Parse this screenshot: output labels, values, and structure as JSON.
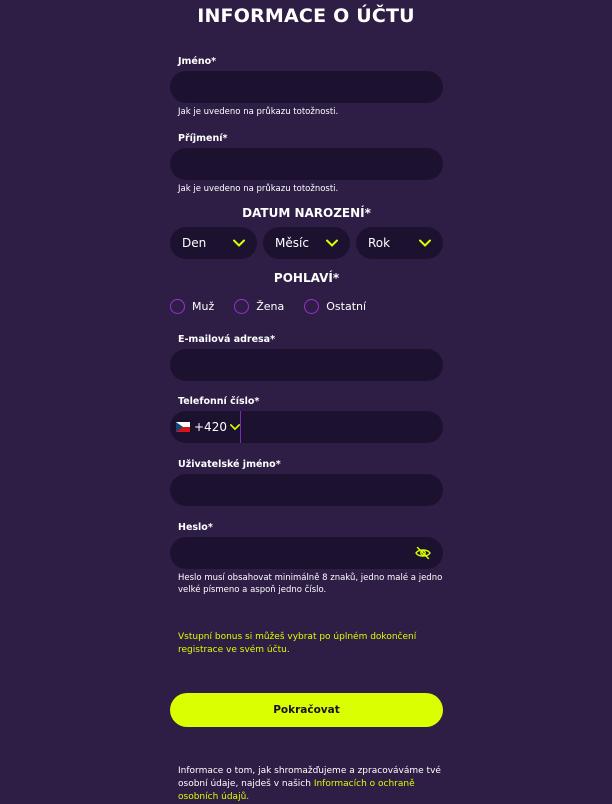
{
  "page_title": "INFORMACE O ÚČTU",
  "first_name": {
    "label": "Jméno*",
    "hint": "Jak je uvedeno na průkazu totožnosti.",
    "value": ""
  },
  "last_name": {
    "label": "Příjmení*",
    "hint": "Jak je uvedeno na průkazu totožnosti.",
    "value": ""
  },
  "birth_date": {
    "heading": "DATUM NAROZENÍ*",
    "day": "Den",
    "month": "Měsíc",
    "year": "Rok"
  },
  "gender": {
    "heading": "POHLAVÍ*",
    "options": [
      "Muž",
      "Žena",
      "Ostatní"
    ]
  },
  "email": {
    "label": "E-mailová adresa*",
    "value": ""
  },
  "phone": {
    "label": "Telefonní číslo*",
    "country_code": "+420",
    "flag": "czech-flag-icon",
    "value": ""
  },
  "username": {
    "label": "Uživatelské jméno*",
    "value": ""
  },
  "password": {
    "label": "Heslo*",
    "hint_line1": "Heslo musí obsahovat minimálně 8 znaků, jedno malé a jedno",
    "hint_line2": "velké písmeno a aspoň jedno číslo.",
    "toggle_icon": "eye-off-icon"
  },
  "bonus_note_line1": "Vstupní bonus si můžeš vybrat po úplném dokončení",
  "bonus_note_line2": "registrace ve svém účtu.",
  "continue_label": "Pokračovat",
  "privacy": {
    "line1": "Informace o tom, jak shromažďujeme a zpracováváme tvé",
    "line2_prefix": "osobní údaje, najdeš v našich ",
    "link_part1": "Informacích o ochraně",
    "link_part2": "osobních údajů."
  },
  "colors": {
    "background": "#2e1e45",
    "field": "#1d1130",
    "accent": "#d9ff00",
    "radio": "#9b2fd6"
  }
}
